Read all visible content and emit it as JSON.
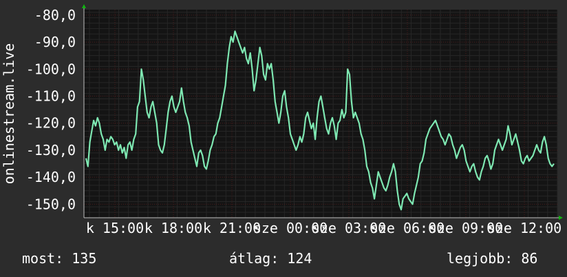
{
  "chart_data": {
    "type": "line",
    "ylabel": "onlinestream.live",
    "y_ticks": [
      "-80,0",
      "-90,0",
      "-100,0",
      "-110,0",
      "-120,0",
      "-130,0",
      "-140,0",
      "-150,0"
    ],
    "y_tick_values": [
      -80,
      -90,
      -100,
      -110,
      -120,
      -130,
      -140,
      -150
    ],
    "ylim": [
      -155,
      -78
    ],
    "x_ticks": [
      "k 15:00",
      "k 18:00",
      "k 21:00",
      "sze 00:00",
      "sze 03:00",
      "sze 06:00",
      "sze 09:00",
      "sze 12:00"
    ],
    "grid": true,
    "series": [
      {
        "values": [
          -133,
          -136,
          -127,
          -123,
          -119,
          -121,
          -118,
          -120,
          -124,
          -126,
          -130,
          -126,
          -127,
          -125,
          -126,
          -128,
          -127,
          -130,
          -128,
          -131,
          -129,
          -133,
          -128,
          -127,
          -130,
          -126,
          -124,
          -114,
          -112,
          -100,
          -104,
          -110,
          -116,
          -118,
          -114,
          -112,
          -116,
          -120,
          -128,
          -130,
          -131,
          -128,
          -122,
          -116,
          -112,
          -110,
          -114,
          -116,
          -114,
          -112,
          -107,
          -112,
          -116,
          -118,
          -121,
          -127,
          -130,
          -133,
          -136,
          -131,
          -130,
          -132,
          -136,
          -137,
          -134,
          -130,
          -128,
          -125,
          -124,
          -120,
          -118,
          -114,
          -110,
          -106,
          -98,
          -92,
          -88,
          -90,
          -86,
          -88,
          -90,
          -92,
          -94,
          -92,
          -96,
          -98,
          -94,
          -100,
          -108,
          -104,
          -98,
          -92,
          -95,
          -102,
          -104,
          -98,
          -100,
          -98,
          -104,
          -112,
          -116,
          -120,
          -116,
          -110,
          -108,
          -114,
          -118,
          -124,
          -126,
          -128,
          -130,
          -128,
          -125,
          -127,
          -124,
          -118,
          -116,
          -119,
          -122,
          -120,
          -126,
          -118,
          -112,
          -110,
          -114,
          -118,
          -122,
          -124,
          -120,
          -118,
          -121,
          -126,
          -120,
          -119,
          -115,
          -118,
          -116,
          -100,
          -102,
          -112,
          -118,
          -116,
          -118,
          -120,
          -124,
          -126,
          -130,
          -136,
          -138,
          -142,
          -144,
          -148,
          -143,
          -138,
          -140,
          -142,
          -144,
          -145,
          -143,
          -140,
          -138,
          -135,
          -138,
          -145,
          -150,
          -152,
          -148,
          -147,
          -146,
          -148,
          -149,
          -150,
          -146,
          -143,
          -140,
          -135,
          -134,
          -131,
          -126,
          -124,
          -122,
          -121,
          -120,
          -119,
          -121,
          -123,
          -125,
          -126,
          -128,
          -126,
          -124,
          -125,
          -128,
          -130,
          -133,
          -131,
          -129,
          -128,
          -130,
          -134,
          -136,
          -138,
          -136,
          -135,
          -138,
          -140,
          -141,
          -138,
          -136,
          -133,
          -132,
          -134,
          -137,
          -135,
          -130,
          -128,
          -126,
          -128,
          -130,
          -128,
          -126,
          -121,
          -124,
          -128,
          -126,
          -124,
          -127,
          -130,
          -134,
          -135,
          -133,
          -132,
          -134,
          -133,
          -132,
          -130,
          -128,
          -130,
          -131,
          -127,
          -125,
          -128,
          -133,
          -135,
          -136,
          -135
        ]
      }
    ]
  },
  "stats": {
    "now": "most: 135",
    "avg": "átlag: 124",
    "best": "legjobb: 86"
  },
  "colors": {
    "background": "#2c2c2c",
    "plot_bg": "#141414",
    "line": "#7ee8b2",
    "grid_major": "#4a1a1a",
    "grid_minor": "#262626",
    "axis": "#c0c0c0",
    "arrow": "#12b412",
    "text": "#ffffff"
  }
}
